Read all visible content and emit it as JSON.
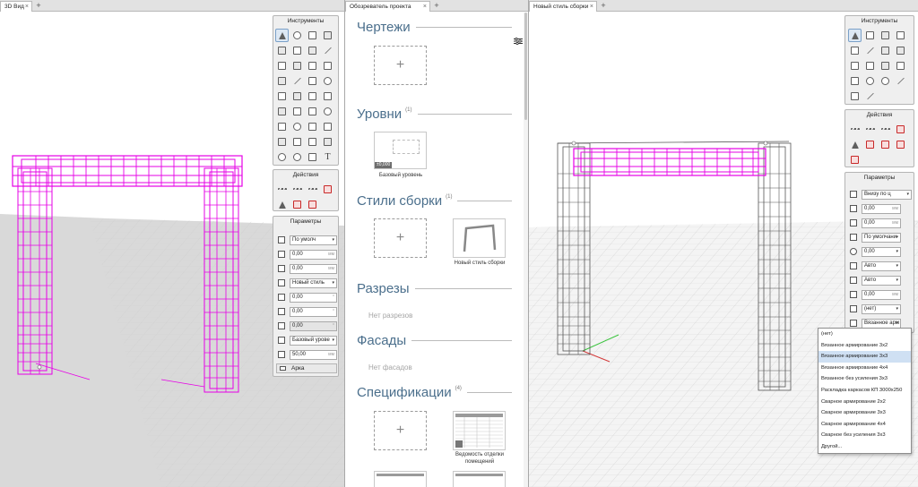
{
  "left_pane": {
    "tab_label": "3D Вид",
    "tools_panel": {
      "title": "Инструменты"
    },
    "actions_panel": {
      "title": "Действия"
    },
    "params_panel": {
      "title": "Параметры",
      "rows": [
        {
          "kind": "select",
          "value": "По умолч"
        },
        {
          "kind": "number",
          "value": "0,00",
          "unit": "мм"
        },
        {
          "kind": "number",
          "value": "0,00",
          "unit": "мм"
        },
        {
          "kind": "select",
          "value": "Новый стиль"
        },
        {
          "kind": "number",
          "value": "0,00",
          "unit": "°"
        },
        {
          "kind": "number",
          "value": "0,00",
          "unit": "°"
        },
        {
          "kind": "number",
          "value": "0,00",
          "unit": "°"
        },
        {
          "kind": "select",
          "value": "Базовый урове"
        },
        {
          "kind": "number",
          "value": "50,00",
          "unit": "мм"
        }
      ],
      "name_value": "Арка"
    }
  },
  "middle_pane": {
    "tab_label": "Обозреватель проекта",
    "sections": {
      "drawings": {
        "title": "Чертежи"
      },
      "levels": {
        "title": "Уровни",
        "count": "(1)",
        "item_label": "Базовый уровень",
        "thumb_text": "±0,000"
      },
      "assembly_styles": {
        "title": "Стили сборки",
        "count": "(1)",
        "item_label": "Новый стиль сборки"
      },
      "sections": {
        "title": "Разрезы",
        "empty_text": "Нет разрезов"
      },
      "facades": {
        "title": "Фасады",
        "empty_text": "Нет фасадов"
      },
      "specifications": {
        "title": "Спецификации",
        "count": "(4)",
        "item_label_1": "Ведомость отделки",
        "item_label_2": "помещений"
      }
    }
  },
  "right_pane": {
    "tab_label": "Новый стиль сборки",
    "tools_panel": {
      "title": "Инструменты"
    },
    "actions_panel": {
      "title": "Действия"
    },
    "params_panel": {
      "title": "Параметры",
      "rows": [
        {
          "kind": "select",
          "value": "Внизу по ц"
        },
        {
          "kind": "number",
          "value": "0,00",
          "unit": "мм"
        },
        {
          "kind": "number",
          "value": "0,00",
          "unit": "мм"
        },
        {
          "kind": "select",
          "value": "По умолчани"
        },
        {
          "kind": "select",
          "value": "0,00"
        },
        {
          "kind": "select",
          "value": "Авто"
        },
        {
          "kind": "select",
          "value": "Авто"
        },
        {
          "kind": "number",
          "value": "0,00",
          "unit": "мм"
        },
        {
          "kind": "select",
          "value": "(нет)"
        },
        {
          "kind": "select",
          "value": "Вязанное арм"
        }
      ]
    },
    "dropdown": {
      "selected_index": 2,
      "options": [
        "(нет)",
        "Вязанное армирование 3х2",
        "Вязанное армирование 3х3",
        "Вязанное армирование 4х4",
        "Вязанное без усиления 3х3",
        "Раскладка каркасов КП 3000х250",
        "Сварное армирование 2х2",
        "Сварное армирование 3х3",
        "Сварное армирование 4х4",
        "Сварное без усиления 3х3",
        "Другой..."
      ]
    }
  },
  "colors": {
    "accent_magenta": "#e600e6",
    "section_blue": "#4b6f8c",
    "panel_bg": "#efefef",
    "selection": "#cfe0f3"
  }
}
